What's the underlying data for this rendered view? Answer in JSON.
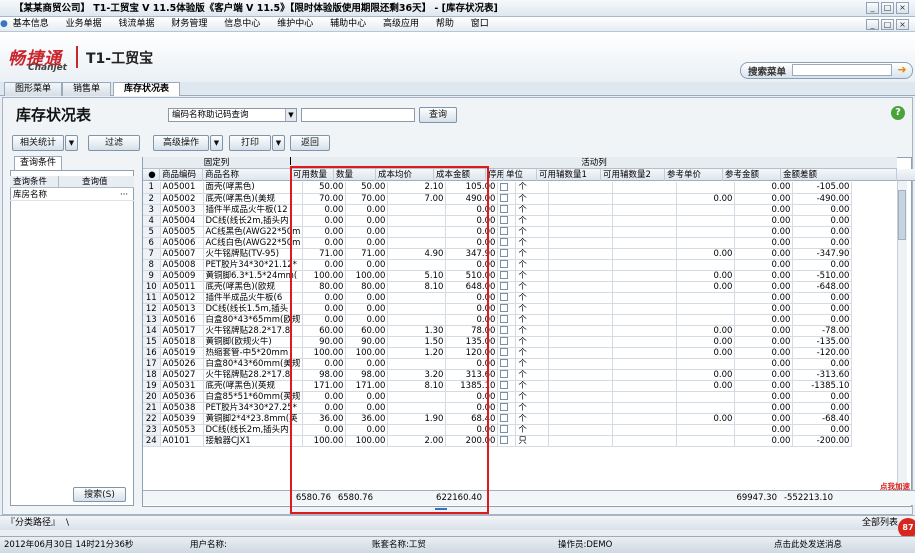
{
  "window": {
    "title": "【某某商贸公司】 T1-工贸宝 V 11.5体验版《客户端 V 11.5》【限时体验版使用期限还剩36天】 - [库存状况表]",
    "controls": [
      "_",
      "□",
      "×"
    ],
    "inner_controls": [
      "_",
      "□",
      "×"
    ]
  },
  "menu": [
    "基本信息",
    "业务单据",
    "钱流单据",
    "财务管理",
    "信息中心",
    "维护中心",
    "辅助中心",
    "高级应用",
    "帮助",
    "窗口"
  ],
  "brand": {
    "cn": "畅捷通",
    "en": "Chanjet",
    "product": "T1-工贸宝"
  },
  "search": {
    "label": "搜索菜单",
    "placeholder": ""
  },
  "tabs": [
    "图形菜单",
    "销售单",
    "库存状况表"
  ],
  "page": {
    "title": "库存状况表",
    "combo_value": "编码名称助记码查询",
    "query_button": "查询",
    "buttons": {
      "stats": "相关统计",
      "filter": "过滤",
      "advanced": "高级操作",
      "print": "打印",
      "back": "返回"
    }
  },
  "left": {
    "tab": "查询条件",
    "headers": [
      "查询条件",
      "查询值"
    ],
    "rows": [
      {
        "cond": "库房名称",
        "value": ""
      }
    ],
    "search_button": "搜索(S)"
  },
  "grid": {
    "groups": {
      "fixed": "固定列",
      "active": "活动列"
    },
    "headers": [
      "●",
      "商品编码",
      "商品名称",
      "可用数量",
      "数量",
      "成本均价",
      "成本金额",
      "停用",
      "单位",
      "可用辅数量1",
      "可用辅数量2",
      "参考单价",
      "参考金额",
      "金额差额"
    ],
    "rows": [
      [
        "1",
        "A05001",
        "面壳(哮黑色)",
        "50.00",
        "50.00",
        "2.10",
        "105.00",
        "个",
        "",
        "",
        "",
        "0.00",
        "-105.00"
      ],
      [
        "2",
        "A05002",
        "底壳(哮黑色)(美规",
        "70.00",
        "70.00",
        "7.00",
        "490.00",
        "个",
        "",
        "",
        "0.00",
        "0.00",
        "-490.00"
      ],
      [
        "3",
        "A05003",
        "插件半成品火牛板(12",
        "0.00",
        "0.00",
        "",
        "0.00",
        "个",
        "",
        "",
        "",
        "0.00",
        "0.00"
      ],
      [
        "4",
        "A05004",
        "DC线(线长2m,插头内",
        "0.00",
        "0.00",
        "",
        "0.00",
        "个",
        "",
        "",
        "",
        "0.00",
        "0.00"
      ],
      [
        "5",
        "A05005",
        "AC线黑色(AWG22*50m",
        "0.00",
        "0.00",
        "",
        "0.00",
        "个",
        "",
        "",
        "",
        "0.00",
        "0.00"
      ],
      [
        "6",
        "A05006",
        "AC线白色(AWG22*50m",
        "0.00",
        "0.00",
        "",
        "0.00",
        "个",
        "",
        "",
        "",
        "0.00",
        "0.00"
      ],
      [
        "7",
        "A05007",
        "火牛铭牌贴(TV-95)",
        "71.00",
        "71.00",
        "4.90",
        "347.90",
        "个",
        "",
        "",
        "0.00",
        "0.00",
        "-347.90"
      ],
      [
        "8",
        "A05008",
        "PET胶片34*30*21.12*",
        "0.00",
        "0.00",
        "",
        "0.00",
        "个",
        "",
        "",
        "",
        "0.00",
        "0.00"
      ],
      [
        "9",
        "A05009",
        "黄铜脚6.3*1.5*24mm(",
        "100.00",
        "100.00",
        "5.10",
        "510.00",
        "个",
        "",
        "",
        "0.00",
        "0.00",
        "-510.00"
      ],
      [
        "10",
        "A05011",
        "底壳(哮黑色)(欧规",
        "80.00",
        "80.00",
        "8.10",
        "648.00",
        "个",
        "",
        "",
        "0.00",
        "0.00",
        "-648.00"
      ],
      [
        "11",
        "A05012",
        "插件半成品火牛板(6",
        "0.00",
        "0.00",
        "",
        "0.00",
        "个",
        "",
        "",
        "",
        "0.00",
        "0.00"
      ],
      [
        "12",
        "A05013",
        "DC线(线长1.5m,插头",
        "0.00",
        "0.00",
        "",
        "0.00",
        "个",
        "",
        "",
        "",
        "0.00",
        "0.00"
      ],
      [
        "13",
        "A05016",
        "白盒80*43*65mm(欧规",
        "0.00",
        "0.00",
        "",
        "0.00",
        "个",
        "",
        "",
        "",
        "0.00",
        "0.00"
      ],
      [
        "14",
        "A05017",
        "火牛铭牌贴28.2*17.8",
        "60.00",
        "60.00",
        "1.30",
        "78.00",
        "个",
        "",
        "",
        "0.00",
        "0.00",
        "-78.00"
      ],
      [
        "15",
        "A05018",
        "黄铜脚(欧规火牛)",
        "90.00",
        "90.00",
        "1.50",
        "135.00",
        "个",
        "",
        "",
        "0.00",
        "0.00",
        "-135.00"
      ],
      [
        "16",
        "A05019",
        "热缩套管-中5*20mm",
        "100.00",
        "100.00",
        "1.20",
        "120.00",
        "个",
        "",
        "",
        "0.00",
        "0.00",
        "-120.00"
      ],
      [
        "17",
        "A05026",
        "白盒80*43*60mm(美规",
        "0.00",
        "0.00",
        "",
        "0.00",
        "个",
        "",
        "",
        "",
        "0.00",
        "0.00"
      ],
      [
        "18",
        "A05027",
        "火牛铭牌贴28.2*17.8",
        "98.00",
        "98.00",
        "3.20",
        "313.60",
        "个",
        "",
        "",
        "0.00",
        "0.00",
        "-313.60"
      ],
      [
        "19",
        "A05031",
        "底壳(哮黑色)(英规",
        "171.00",
        "171.00",
        "8.10",
        "1385.10",
        "个",
        "",
        "",
        "0.00",
        "0.00",
        "-1385.10"
      ],
      [
        "20",
        "A05036",
        "白盒85*51*60mm(英规",
        "0.00",
        "0.00",
        "",
        "0.00",
        "个",
        "",
        "",
        "",
        "0.00",
        "0.00"
      ],
      [
        "21",
        "A05038",
        "PET胶片34*30*27.25*",
        "0.00",
        "0.00",
        "",
        "0.00",
        "个",
        "",
        "",
        "",
        "0.00",
        "0.00"
      ],
      [
        "22",
        "A05039",
        "黄铜脚2*4*23.8mm(英",
        "36.00",
        "36.00",
        "1.90",
        "68.40",
        "个",
        "",
        "",
        "0.00",
        "0.00",
        "-68.40"
      ],
      [
        "23",
        "A05053",
        "DC线(线长2m,插头内",
        "0.00",
        "0.00",
        "",
        "0.00",
        "个",
        "",
        "",
        "",
        "0.00",
        "0.00"
      ],
      [
        "24",
        "A0101",
        "接触器CJX1",
        "100.00",
        "100.00",
        "2.00",
        "200.00",
        "只",
        "",
        "",
        "",
        "0.00",
        "-200.00"
      ]
    ],
    "totals": {
      "avail": "6580.76",
      "qty": "6580.76",
      "amount": "622160.40",
      "ref_amount": "69947.30",
      "diff": "-552213.10"
    }
  },
  "bottom": {
    "path": "『分类路径』",
    "path_sep": "\\",
    "all_columns": "全部列表",
    "float_tip": "点我加速",
    "badge": "87"
  },
  "status": {
    "date": "2012年06月30日  14时21分36秒",
    "user": "用户名称:",
    "account": "账套名称:工贸",
    "operator": "操作员:DEMO",
    "message": "点击此处发送消息"
  },
  "colors": {
    "highlight_box": "#e01a1a",
    "brand_red": "#c8252c"
  }
}
